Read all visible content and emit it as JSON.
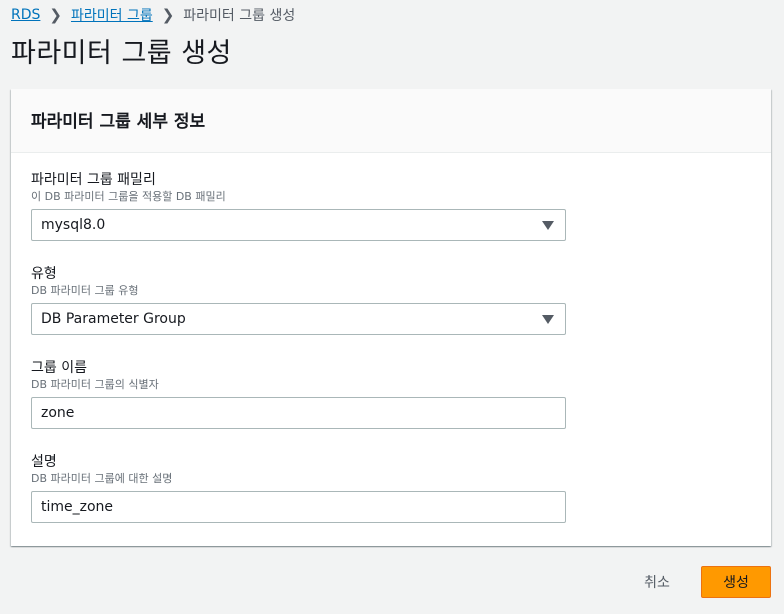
{
  "breadcrumb": {
    "items": [
      "RDS",
      "파라미터 그룹",
      "파라미터 그룹 생성"
    ]
  },
  "page_title": "파라미터 그룹 생성",
  "panel": {
    "title": "파라미터 그룹 세부 정보",
    "fields": [
      {
        "label": "파라미터 그룹 패밀리",
        "description": "이 DB 파라미터 그룹을 적용할 DB 패밀리",
        "value": "mysql8.0",
        "type": "select"
      },
      {
        "label": "유형",
        "description": "DB 파라미터 그룹 유형",
        "value": "DB Parameter Group",
        "type": "select"
      },
      {
        "label": "그룹 이름",
        "description": "DB 파라미터 그룹의 식별자",
        "value": "zone",
        "type": "text"
      },
      {
        "label": "설명",
        "description": "DB 파라미터 그룹에 대한 설명",
        "value": "time_zone",
        "type": "text"
      }
    ]
  },
  "footer": {
    "cancel_label": "취소",
    "create_label": "생성"
  },
  "colors": {
    "link": "#0073bb",
    "primary_button": "#ff9900",
    "page_background": "#f2f3f3"
  },
  "icons": {
    "breadcrumb_separator": "chevron-right-icon",
    "select_arrow": "caret-down-icon"
  }
}
